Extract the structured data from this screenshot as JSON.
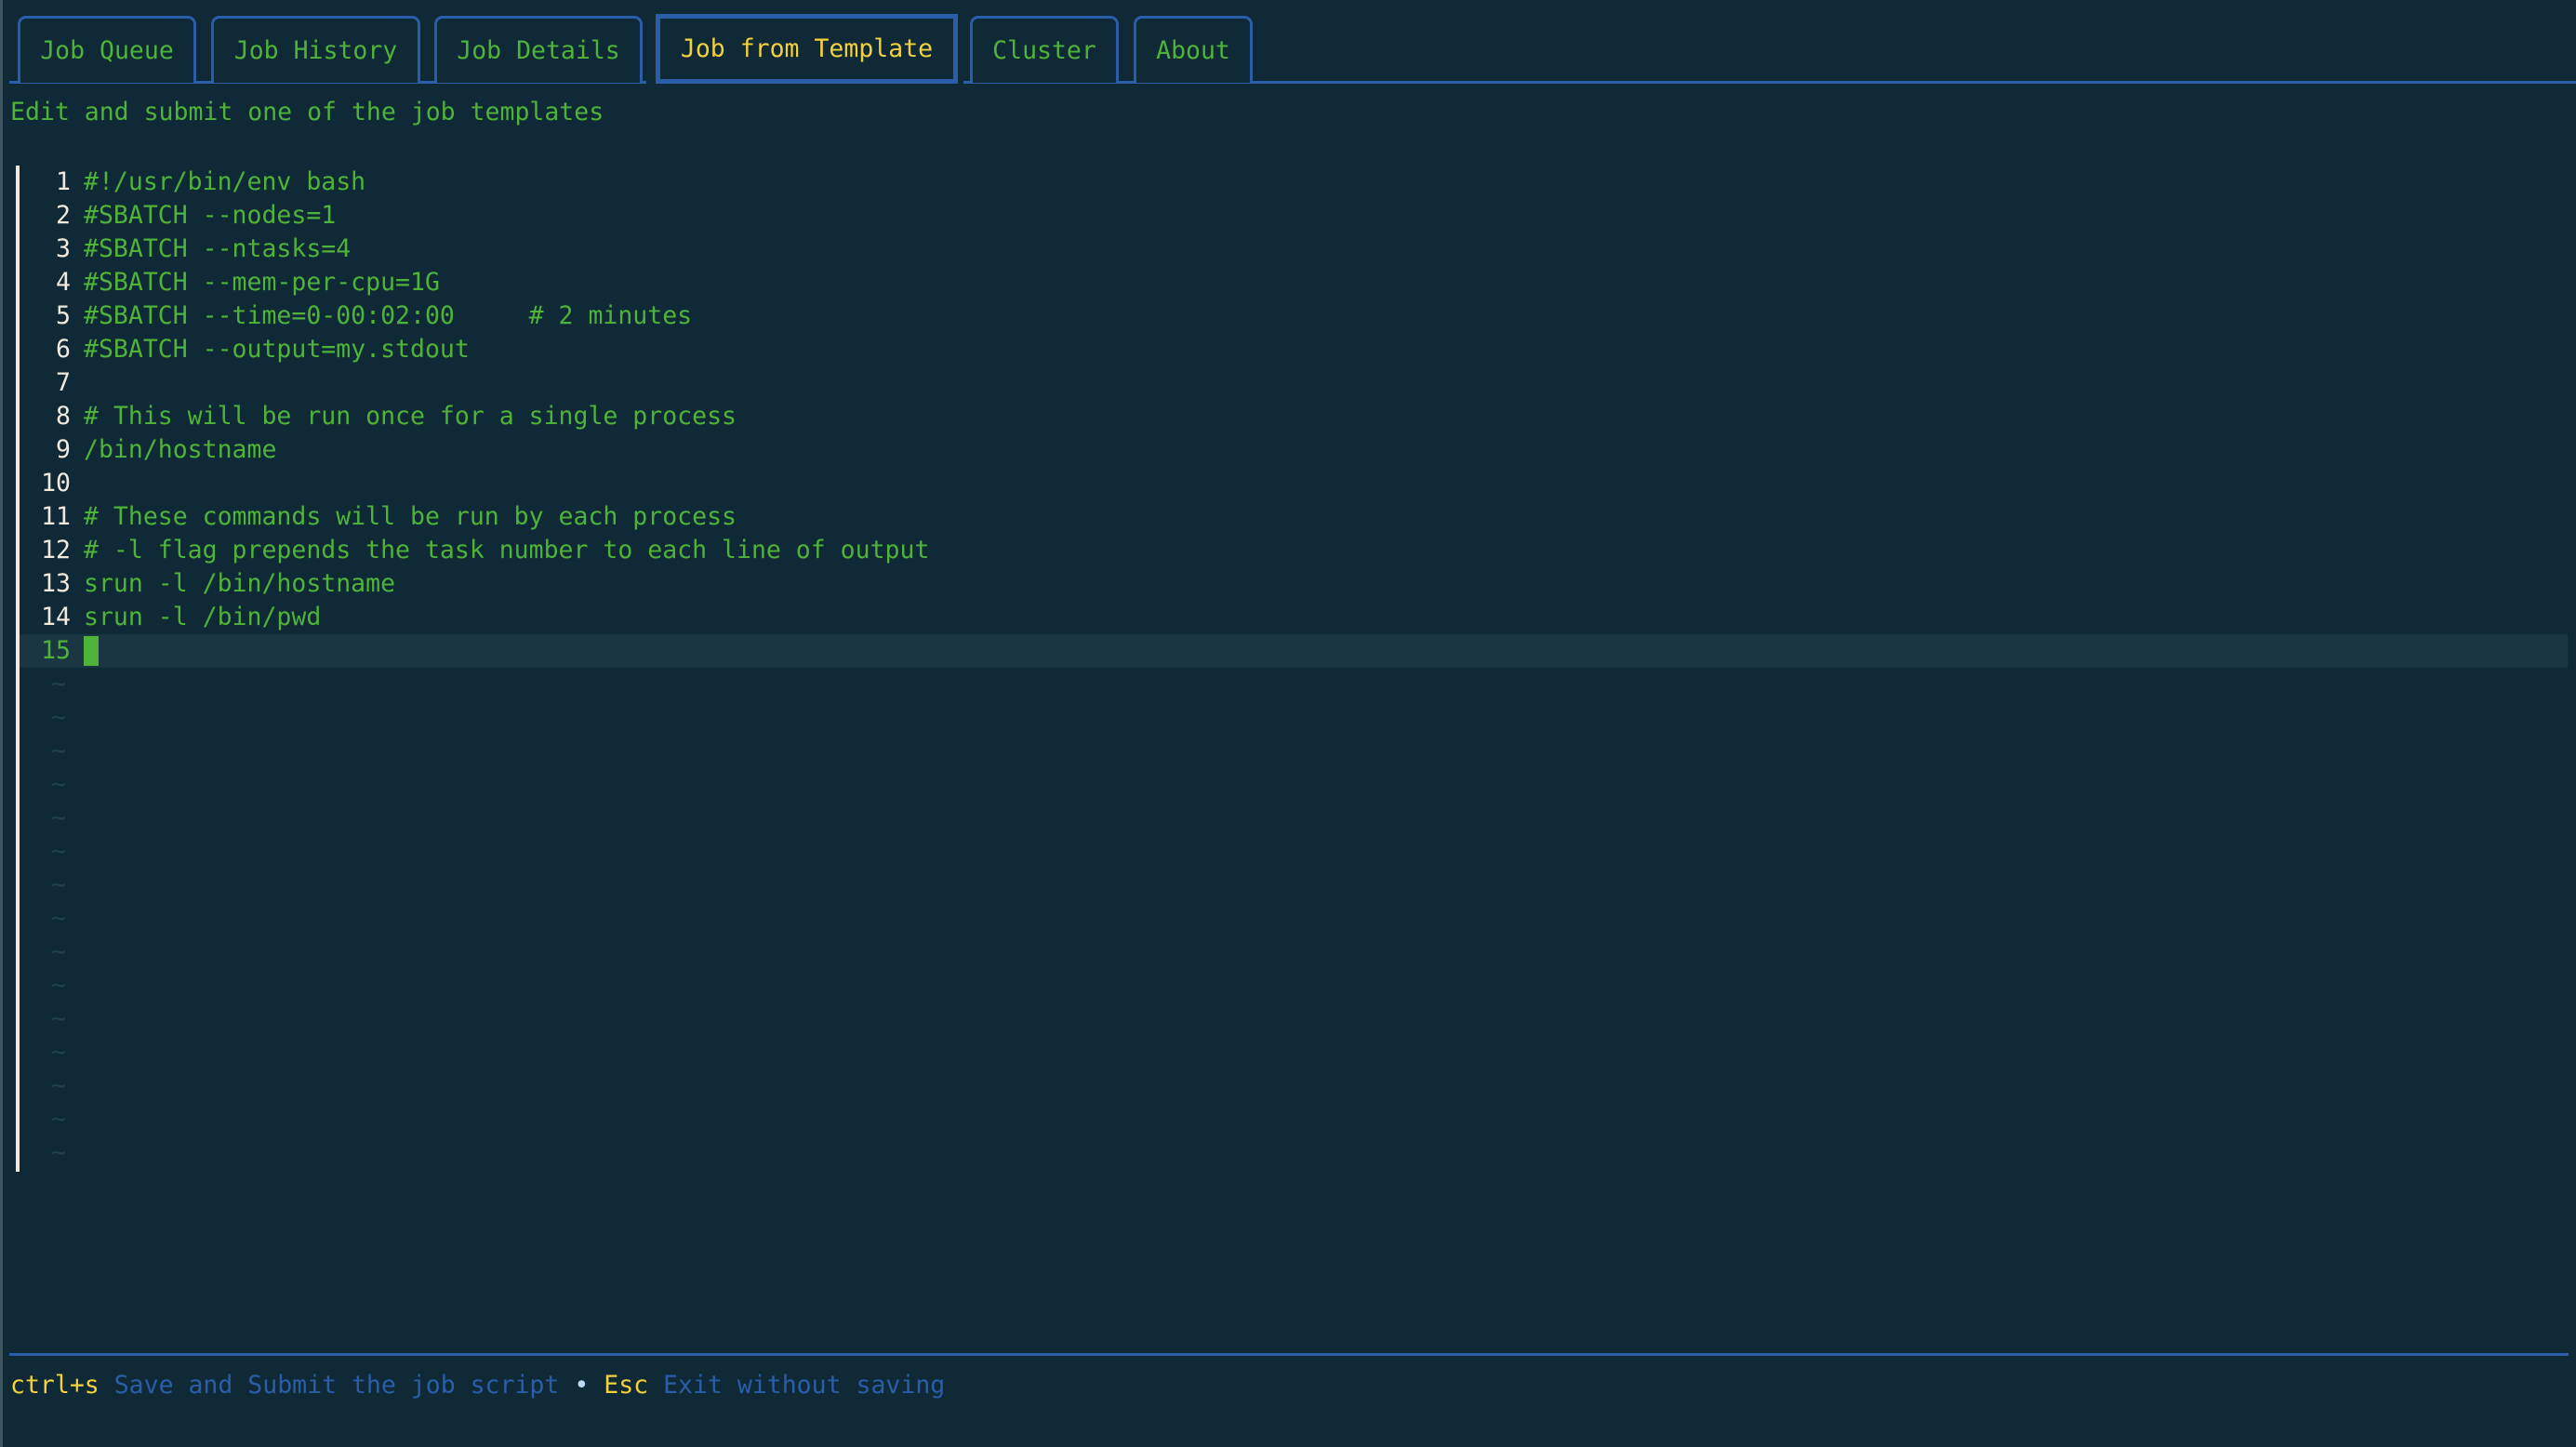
{
  "tabs": [
    {
      "label": "Job Queue",
      "active": false
    },
    {
      "label": "Job History",
      "active": false
    },
    {
      "label": "Job Details",
      "active": false
    },
    {
      "label": "Job from Template",
      "active": true
    },
    {
      "label": "Cluster",
      "active": false
    },
    {
      "label": "About",
      "active": false
    }
  ],
  "subtitle": "Edit and submit one of the job templates",
  "editor": {
    "lines": [
      "#!/usr/bin/env bash",
      "#SBATCH --nodes=1",
      "#SBATCH --ntasks=4",
      "#SBATCH --mem-per-cpu=1G",
      "#SBATCH --time=0-00:02:00     # 2 minutes",
      "#SBATCH --output=my.stdout",
      "",
      "# This will be run once for a single process",
      "/bin/hostname",
      "",
      "# These commands will be run by each process",
      "# -l flag prepends the task number to each line of output",
      "srun -l /bin/hostname",
      "srun -l /bin/pwd",
      ""
    ],
    "active_line": 15,
    "empty_line_marker": "~",
    "empty_line_count": 15
  },
  "footer": {
    "shortcuts": [
      {
        "key": "ctrl+s",
        "description": "Save and Submit the job script"
      },
      {
        "key": "Esc",
        "description": "Exit without saving"
      }
    ],
    "separator": "•"
  },
  "colors": {
    "background": "#0f2936",
    "accent_border": "#2a5ea8",
    "text_green": "#4fb33a",
    "active_tab_text": "#f2d13d",
    "line_number": "#efeadb"
  }
}
